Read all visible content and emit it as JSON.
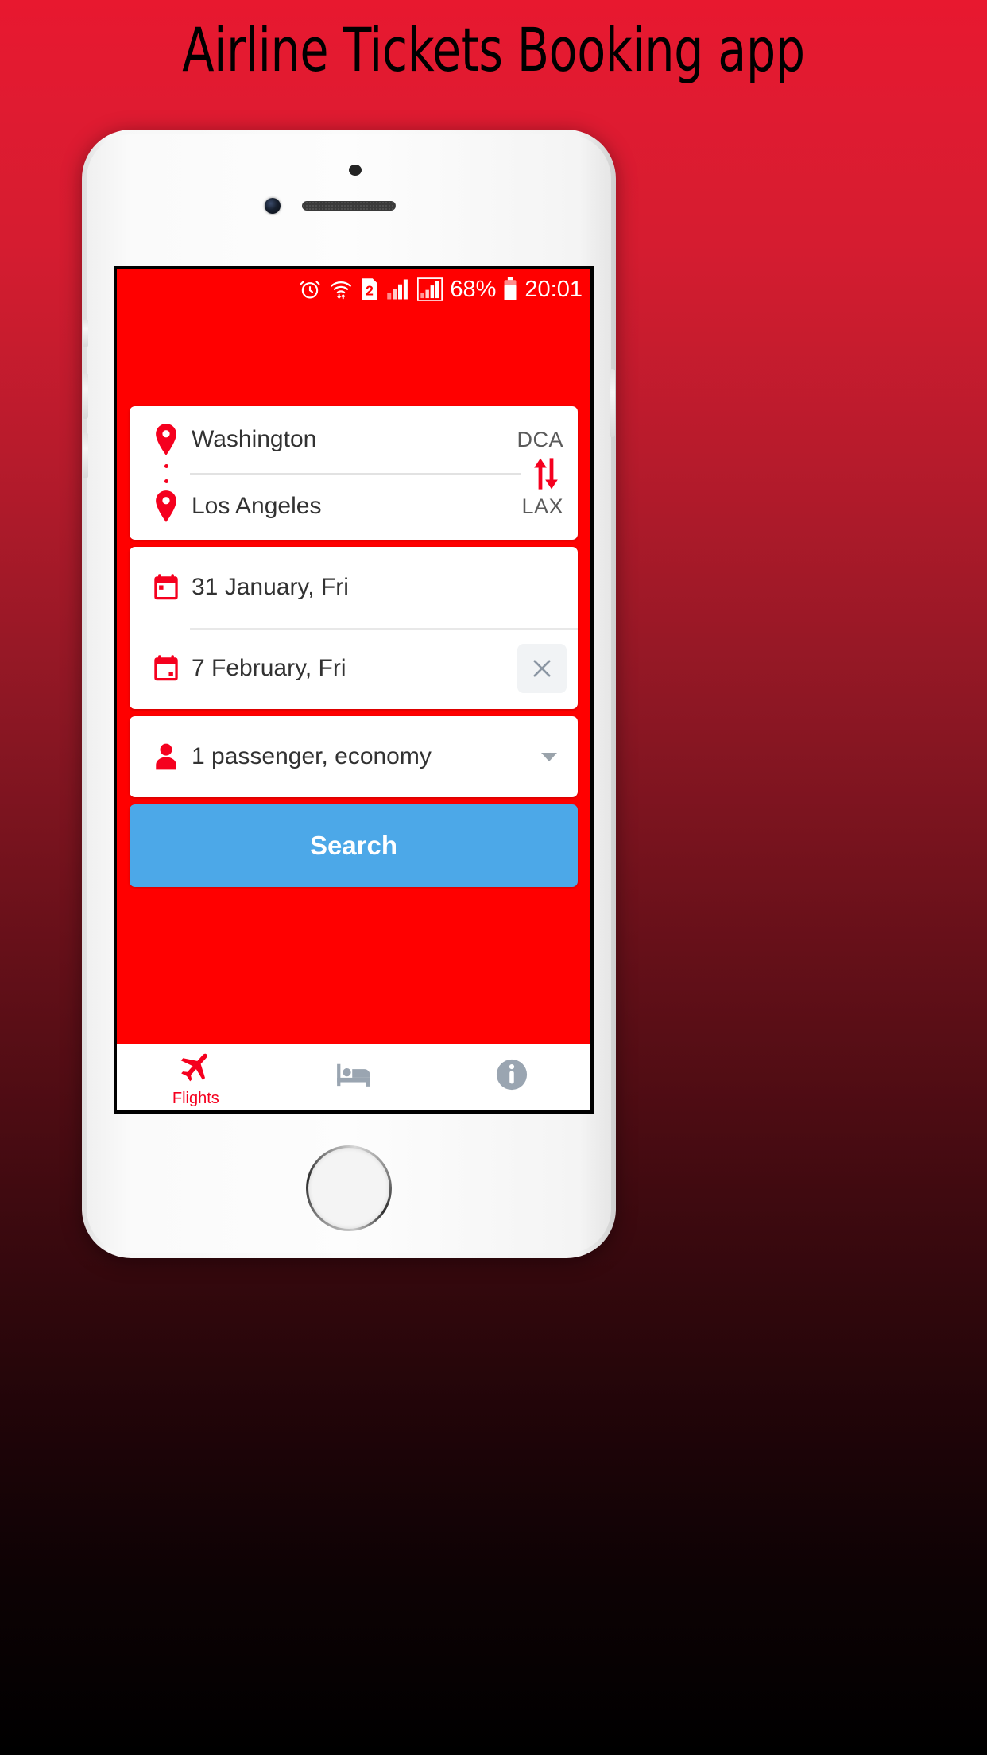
{
  "page": {
    "title": "Airline Tickets Booking app",
    "background_top_color": "#e8182f",
    "background_bottom_color": "#000000"
  },
  "statusbar": {
    "icons": [
      "alarm-clock-icon",
      "wifi-icon",
      "sim-2-icon",
      "signal-1-icon",
      "signal-2-icon",
      "battery-icon"
    ],
    "sim_badge": "2",
    "battery_percent": "68%",
    "time": "20:01"
  },
  "app": {
    "accent_color": "#ff0000",
    "search_button_color": "#4ca8e8",
    "route": {
      "origin": {
        "city": "Washington",
        "code": "DCA",
        "pin_icon": "map-pin-icon"
      },
      "destination": {
        "city": "Los Angeles",
        "code": "LAX",
        "pin_icon": "map-pin-icon"
      },
      "swap_icon": "swap-vertical-icon"
    },
    "dates": {
      "depart": {
        "label": "31 January, Fri",
        "icon": "calendar-icon"
      },
      "return": {
        "label": "7 February, Fri",
        "icon": "calendar-icon"
      },
      "clear_icon": "close-icon"
    },
    "passengers": {
      "label": "1 passenger, economy",
      "icon": "person-icon",
      "dropdown_icon": "chevron-down-icon"
    },
    "search_label": "Search",
    "bottom_nav": [
      {
        "label": "Flights",
        "icon": "airplane-icon",
        "active": true
      },
      {
        "label": "",
        "icon": "hotel-bed-icon",
        "active": false
      },
      {
        "label": "",
        "icon": "info-circle-icon",
        "active": false
      }
    ]
  }
}
